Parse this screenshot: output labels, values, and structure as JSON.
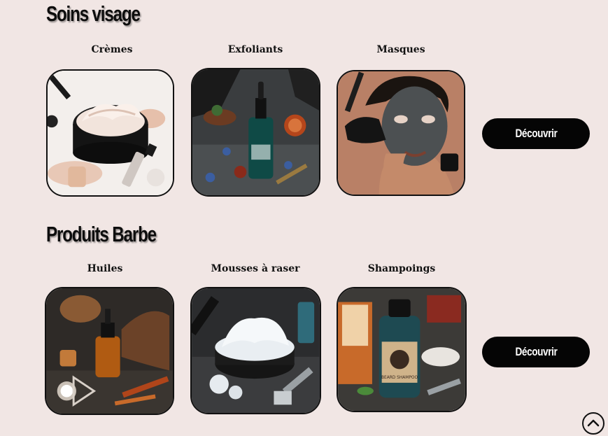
{
  "sections": [
    {
      "title": "Soins visage",
      "button_label": "Découvrir",
      "categories": [
        "Crèmes",
        "Exfoliants",
        "Masques"
      ]
    },
    {
      "title": "Produits Barbe",
      "button_label": "Découvrir",
      "categories": [
        "Huiles",
        "Mousses à raser",
        "Shampoings"
      ]
    }
  ],
  "images": {
    "bottle_label": "BEARD SHAMPOO"
  },
  "icons": {
    "scroll_top": "chevron-up-circle-icon"
  },
  "colors": {
    "background": "#f1e6e4",
    "button": "#050505",
    "button_text": "#ffffff"
  }
}
